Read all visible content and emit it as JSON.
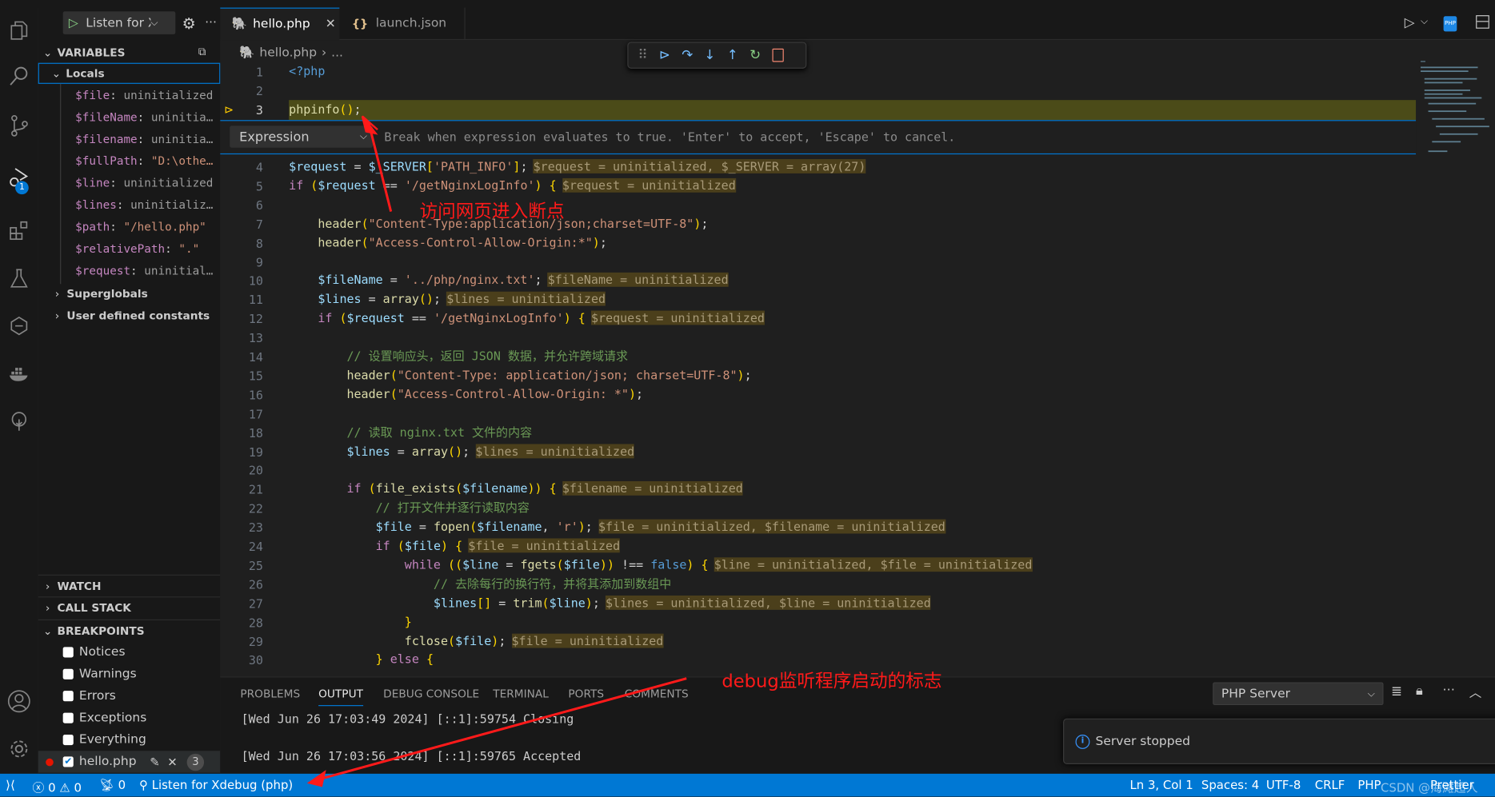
{
  "sidebar": {
    "run_config": "Listen for X",
    "variables_title": "VARIABLES",
    "locals_label": "Locals",
    "locals": [
      {
        "name": "$file",
        "value": "uninitialized",
        "kind": "u"
      },
      {
        "name": "$fileName",
        "value": "uninitia…",
        "kind": "u"
      },
      {
        "name": "$filename",
        "value": "uninitia…",
        "kind": "u"
      },
      {
        "name": "$fullPath",
        "value": "\"D:\\othe…",
        "kind": "s"
      },
      {
        "name": "$line",
        "value": "uninitialized",
        "kind": "u"
      },
      {
        "name": "$lines",
        "value": "uninitializ…",
        "kind": "u"
      },
      {
        "name": "$path",
        "value": "\"/hello.php\"",
        "kind": "s"
      },
      {
        "name": "$relativePath",
        "value": "\".\"",
        "kind": "s"
      },
      {
        "name": "$request",
        "value": "uninitial…",
        "kind": "u"
      }
    ],
    "superglobals_label": "Superglobals",
    "constants_label": "User defined constants",
    "watch_title": "WATCH",
    "callstack_title": "CALL STACK",
    "breakpoints_title": "BREAKPOINTS",
    "breakpoints": [
      "Notices",
      "Warnings",
      "Errors",
      "Exceptions",
      "Everything"
    ],
    "file_breakpoint": {
      "label": "hello.php",
      "checked": true,
      "count": "3"
    },
    "debug_badge": "1"
  },
  "tabs": [
    {
      "label": "hello.php",
      "active": true
    },
    {
      "label": "launch.json",
      "active": false
    }
  ],
  "breadcrumb": {
    "file": "hello.php",
    "rest": "..."
  },
  "breakpoint_widget": {
    "type": "Expression",
    "hint": "Break when expression evaluates to true. 'Enter' to accept, 'Escape' to cancel."
  },
  "code": [
    {
      "n": "1",
      "text": "<?php"
    },
    {
      "n": "2",
      "text": ""
    },
    {
      "n": "3",
      "text": "phpinfo();",
      "current": true
    },
    {
      "n": "4",
      "text": "$request = $_SERVER['PATH_INFO'];",
      "inline": "$request = uninitialized, $_SERVER = array(27)"
    },
    {
      "n": "5",
      "text": "if ($request == '/getNginxLogInfo') {",
      "inline": "$request = uninitialized"
    },
    {
      "n": "6",
      "text": ""
    },
    {
      "n": "7",
      "text": "    header(\"Content-Type:application/json;charset=UTF-8\");"
    },
    {
      "n": "8",
      "text": "    header(\"Access-Control-Allow-Origin:*\");"
    },
    {
      "n": "9",
      "text": ""
    },
    {
      "n": "10",
      "text": "    $fileName = '../php/nginx.txt';",
      "inline": "$fileName = uninitialized"
    },
    {
      "n": "11",
      "text": "    $lines = array();",
      "inline": "$lines = uninitialized"
    },
    {
      "n": "12",
      "text": "    if ($request == '/getNginxLogInfo') {",
      "inline": "$request = uninitialized"
    },
    {
      "n": "13",
      "text": ""
    },
    {
      "n": "14",
      "text": "        // 设置响应头，返回 JSON 数据，并允许跨域请求"
    },
    {
      "n": "15",
      "text": "        header(\"Content-Type: application/json; charset=UTF-8\");"
    },
    {
      "n": "16",
      "text": "        header(\"Access-Control-Allow-Origin: *\");"
    },
    {
      "n": "17",
      "text": ""
    },
    {
      "n": "18",
      "text": "        // 读取 nginx.txt 文件的内容"
    },
    {
      "n": "19",
      "text": "        $lines = array();",
      "inline": "$lines = uninitialized"
    },
    {
      "n": "20",
      "text": ""
    },
    {
      "n": "21",
      "text": "        if (file_exists($filename)) {",
      "inline": "$filename = uninitialized"
    },
    {
      "n": "22",
      "text": "            // 打开文件并逐行读取内容"
    },
    {
      "n": "23",
      "text": "            $file = fopen($filename, 'r');",
      "inline": "$file = uninitialized, $filename = uninitialized"
    },
    {
      "n": "24",
      "text": "            if ($file) {",
      "inline": "$file = uninitialized"
    },
    {
      "n": "25",
      "text": "                while (($line = fgets($file)) !== false) {",
      "inline": "$line = uninitialized, $file = uninitialized"
    },
    {
      "n": "26",
      "text": "                    // 去除每行的换行符，并将其添加到数组中"
    },
    {
      "n": "27",
      "text": "                    $lines[] = trim($line);",
      "inline": "$lines = uninitialized, $line = uninitialized"
    },
    {
      "n": "28",
      "text": "                }"
    },
    {
      "n": "29",
      "text": "                fclose($file);",
      "inline": "$file = uninitialized"
    },
    {
      "n": "30",
      "text": "            } else {"
    }
  ],
  "panel": {
    "tabs": [
      "PROBLEMS",
      "OUTPUT",
      "DEBUG CONSOLE",
      "TERMINAL",
      "PORTS",
      "COMMENTS"
    ],
    "active_tab": "OUTPUT",
    "output_source": "PHP Server",
    "output_lines": [
      "[Wed Jun 26 17:03:49 2024] [::1]:59754 Closing",
      "",
      "[Wed Jun 26 17:03:56 2024] [::1]:59765 Accepted"
    ]
  },
  "notification": {
    "text": "Server stopped"
  },
  "status": {
    "errors": "0",
    "warnings": "0",
    "ports": "0",
    "debug_config": "Listen for Xdebug (php)",
    "position": "Ln 3, Col 1",
    "spaces": "Spaces: 4",
    "encoding": "UTF-8",
    "eol": "CRLF",
    "language": "PHP",
    "formatter": "Prettier"
  },
  "annotations": {
    "breakpoint_note": "访问网页进入断点",
    "listener_note": "debug监听程序启动的标志",
    "watermark": "CSDN @海滩超人"
  },
  "colors": {
    "accent": "#0078d4",
    "current_line": "#4b4b18",
    "annotation": "#ff1a1a",
    "inline_value_bg": "#4b3f1b"
  }
}
